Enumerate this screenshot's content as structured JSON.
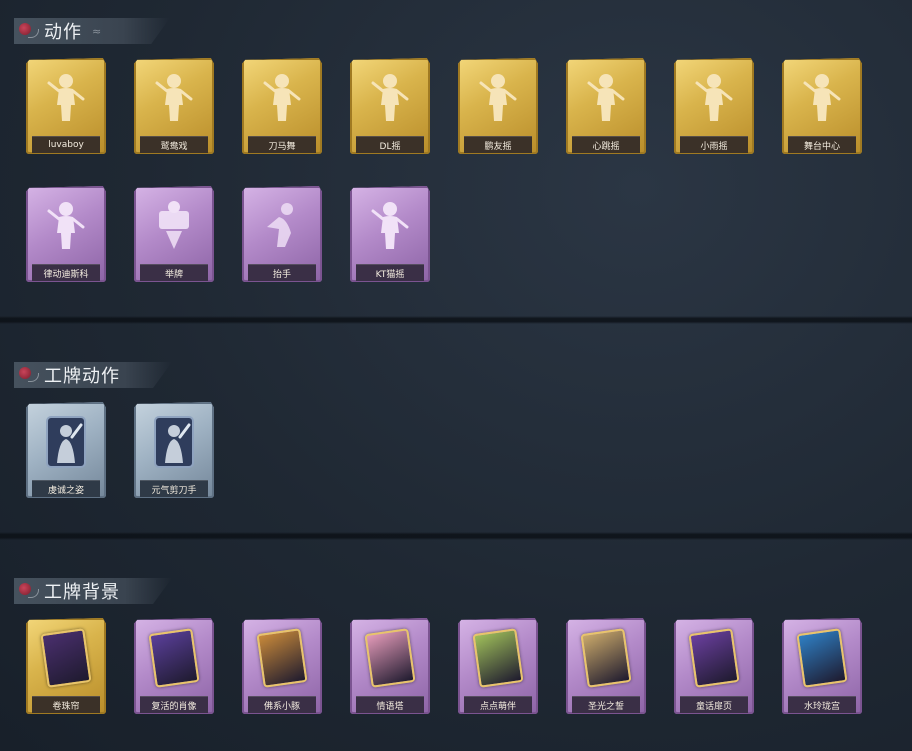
{
  "sections": [
    {
      "title": "动作",
      "deco": "≈",
      "items": [
        {
          "label": "luvaboy",
          "rarity": "gold",
          "icon": "dance-figure-icon"
        },
        {
          "label": "鹫鸯戏",
          "rarity": "gold",
          "icon": "dance-figure-icon"
        },
        {
          "label": "刀马舞",
          "rarity": "gold",
          "icon": "dance-figure-icon"
        },
        {
          "label": "DL摇",
          "rarity": "gold",
          "icon": "dance-figure-icon"
        },
        {
          "label": "鹏友摇",
          "rarity": "gold",
          "icon": "dance-figure-icon"
        },
        {
          "label": "心跳摇",
          "rarity": "gold",
          "icon": "dance-figure-icon"
        },
        {
          "label": "小雨摇",
          "rarity": "gold",
          "icon": "dance-figure-icon"
        },
        {
          "label": "舞台中心",
          "rarity": "gold",
          "icon": "dance-figure-icon"
        },
        {
          "label": "律动迪斯科",
          "rarity": "purple",
          "icon": "dance-figure-icon"
        },
        {
          "label": "举牌",
          "rarity": "purple",
          "icon": "sign-holding-icon"
        },
        {
          "label": "抬手",
          "rarity": "purple",
          "icon": "hand-raise-icon"
        },
        {
          "label": "KT猫摇",
          "rarity": "purple",
          "icon": "dance-figure-icon"
        }
      ]
    },
    {
      "title": "工牌动作",
      "deco": "",
      "items": [
        {
          "label": "虔诚之姿",
          "rarity": "blue",
          "icon": "badge-pose-icon"
        },
        {
          "label": "元气剪刀手",
          "rarity": "blue",
          "icon": "badge-pose-icon"
        }
      ]
    },
    {
      "title": "工牌背景",
      "deco": "",
      "items": [
        {
          "label": "卷珠帘",
          "rarity": "gold",
          "icon": "badge-background-icon",
          "tint": "#4a2f6e"
        },
        {
          "label": "复活的肖像",
          "rarity": "purple",
          "icon": "badge-background-icon",
          "tint": "#5a3f9a"
        },
        {
          "label": "佛系小豚",
          "rarity": "purple",
          "icon": "badge-background-icon",
          "tint": "#c8893a"
        },
        {
          "label": "情语塔",
          "rarity": "purple",
          "icon": "badge-background-icon",
          "tint": "#e39ab8"
        },
        {
          "label": "点点萌伴",
          "rarity": "purple",
          "icon": "badge-background-icon",
          "tint": "#9fbf5a"
        },
        {
          "label": "圣光之誓",
          "rarity": "purple",
          "icon": "badge-background-icon",
          "tint": "#c9a86a"
        },
        {
          "label": "童话扉页",
          "rarity": "purple",
          "icon": "badge-background-icon",
          "tint": "#6a3f9e"
        },
        {
          "label": "水玲珑宫",
          "rarity": "purple",
          "icon": "badge-background-icon",
          "tint": "#2f7fc4"
        }
      ]
    }
  ]
}
